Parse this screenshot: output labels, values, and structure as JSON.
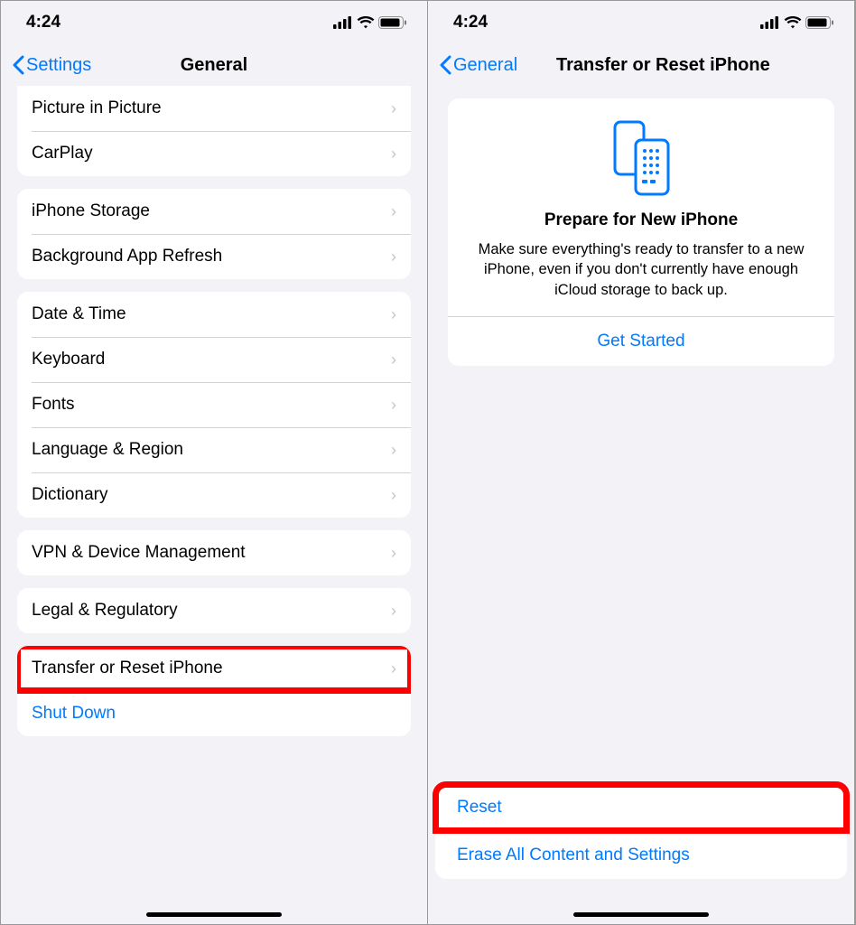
{
  "status": {
    "time": "4:24"
  },
  "left": {
    "back_label": "Settings",
    "title": "General",
    "g1": [
      "Picture in Picture",
      "CarPlay"
    ],
    "g2": [
      "iPhone Storage",
      "Background App Refresh"
    ],
    "g3": [
      "Date & Time",
      "Keyboard",
      "Fonts",
      "Language & Region",
      "Dictionary"
    ],
    "g4": [
      "VPN & Device Management"
    ],
    "g5": [
      "Legal & Regulatory"
    ],
    "g6_transfer": "Transfer or Reset iPhone",
    "g6_shutdown": "Shut Down"
  },
  "right": {
    "back_label": "General",
    "title": "Transfer or Reset iPhone",
    "card_title": "Prepare for New iPhone",
    "card_desc": "Make sure everything's ready to transfer to a new iPhone, even if you don't currently have enough iCloud storage to back up.",
    "card_action": "Get Started",
    "reset": "Reset",
    "erase": "Erase All Content and Settings"
  }
}
